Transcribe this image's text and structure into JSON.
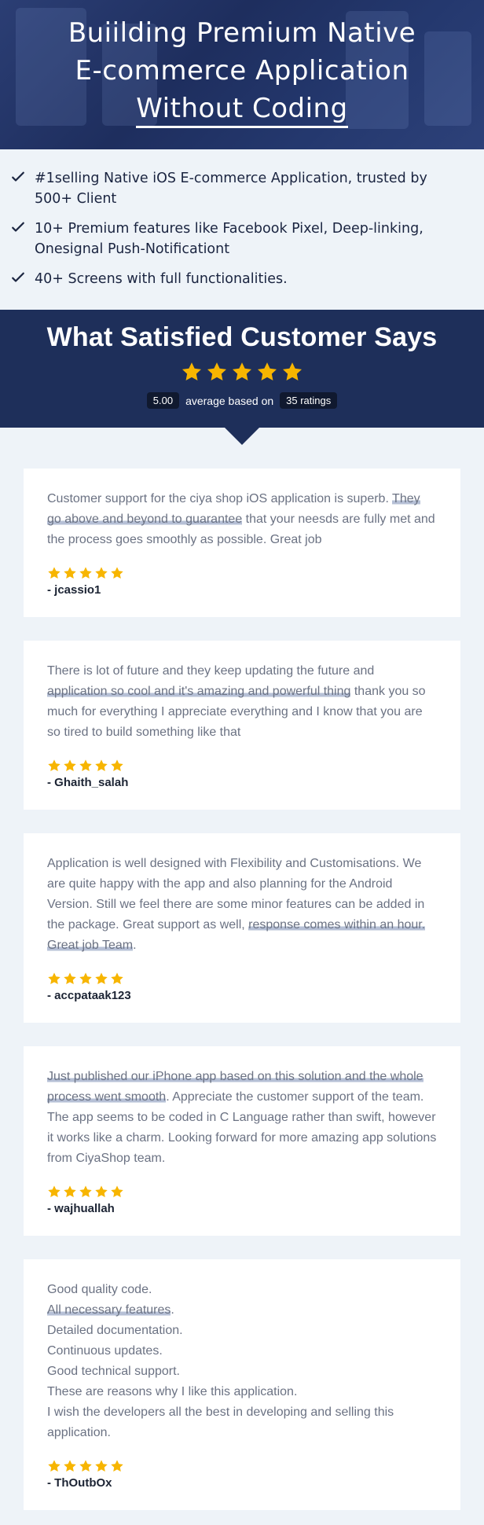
{
  "hero": {
    "title_line1": "Buiilding Premium Native",
    "title_line2": "E-commerce Application",
    "title_line3": "Without Coding"
  },
  "bullets": [
    {
      "text": "#1selling Native iOS E-commerce Application, trusted by 500+ Client"
    },
    {
      "text": "10+ Premium features like Facebook Pixel, Deep-linking, Onesignal Push-Notificationt"
    },
    {
      "text": "40+ Screens with full functionalities."
    }
  ],
  "ratings": {
    "title": "What Satisfied Customer Says",
    "stars": 5,
    "average": "5.00",
    "average_label": "average based on",
    "count_label": "35 ratings"
  },
  "reviews": [
    {
      "pre": "Customer support for the ciya shop iOS application is superb. ",
      "highlight": "They go above and beyond to guarantee",
      "post": " that your neesds are fully met and the process goes smoothly as possible. Great job",
      "stars": 5,
      "author": "- jcassio1"
    },
    {
      "pre": "There is lot of future and they keep updating the future and ",
      "highlight": "application so cool and it's amazing and powerful thing",
      "post": " thank you so much for everything I appreciate everything and I know that you are so tired to build something like that",
      "stars": 5,
      "author": "- Ghaith_salah"
    },
    {
      "pre": "Application is well designed with Flexibility and Customisations. We are quite happy with the app and also planning for the Android Version. Still we feel there are some minor features can be added in the package. Great support as well, ",
      "highlight": "response comes within an hour. Great job Team",
      "post": ".",
      "stars": 5,
      "author": "- accpataak123"
    },
    {
      "pre": "",
      "highlight": "Just published our iPhone app based on this solution and the whole process went smooth",
      "post": ". Appreciate the customer support of the team. The app seems to be coded in C Language rather than swift, however it works like a charm. Looking forward for more amazing app solutions from CiyaShop team.",
      "stars": 5,
      "author": "- wajhuallah"
    },
    {
      "lines_before": [
        "Good quality code."
      ],
      "highlight": "All necessary features",
      "highlight_suffix": ".",
      "lines_after": [
        "Detailed documentation.",
        "Continuous updates.",
        "Good technical support.",
        "These are reasons why I like this application.",
        "I wish the developers all the best in developing and selling this application."
      ],
      "stars": 5,
      "author": "- ThOutbOx"
    }
  ],
  "colors": {
    "hero_bg": "#223466",
    "ratings_bg": "#1e2f5a",
    "star": "#f7b500",
    "highlight": "#b6c0d6",
    "check": "#1a2440"
  },
  "icons": {
    "bullet": "check-icon",
    "rating": "star-icon"
  }
}
